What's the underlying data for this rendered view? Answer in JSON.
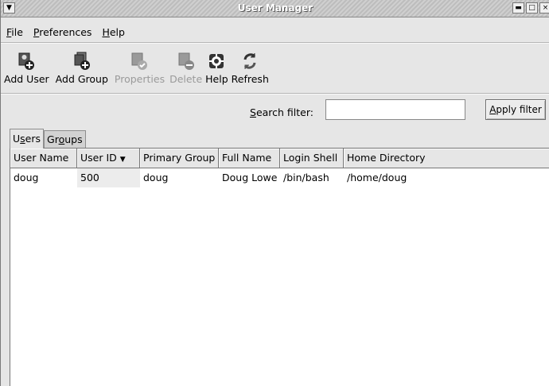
{
  "window": {
    "title": "User Manager"
  },
  "menubar": {
    "items": [
      {
        "accel": "F",
        "rest": "ile"
      },
      {
        "accel": "P",
        "rest": "references"
      },
      {
        "accel": "H",
        "rest": "elp"
      }
    ]
  },
  "toolbar": {
    "add_user": "Add User",
    "add_group": "Add Group",
    "properties": "Properties",
    "delete": "Delete",
    "help": "Help",
    "refresh": "Refresh"
  },
  "search": {
    "label_accel": "S",
    "label_rest": "earch filter:",
    "value": "",
    "apply_accel": "A",
    "apply_rest": "pply filter"
  },
  "tabs": {
    "users_pre": "U",
    "users_accel": "s",
    "users_post": "ers",
    "groups_pre": "Gr",
    "groups_accel": "o",
    "groups_post": "ups"
  },
  "table": {
    "columns": [
      "User Name",
      "User ID",
      "Primary Group",
      "Full Name",
      "Login Shell",
      "Home Directory"
    ],
    "sorted_column": "User ID",
    "rows": [
      [
        "doug",
        "500",
        "doug",
        "Doug Lowe",
        "/bin/bash",
        "/home/doug"
      ]
    ]
  }
}
